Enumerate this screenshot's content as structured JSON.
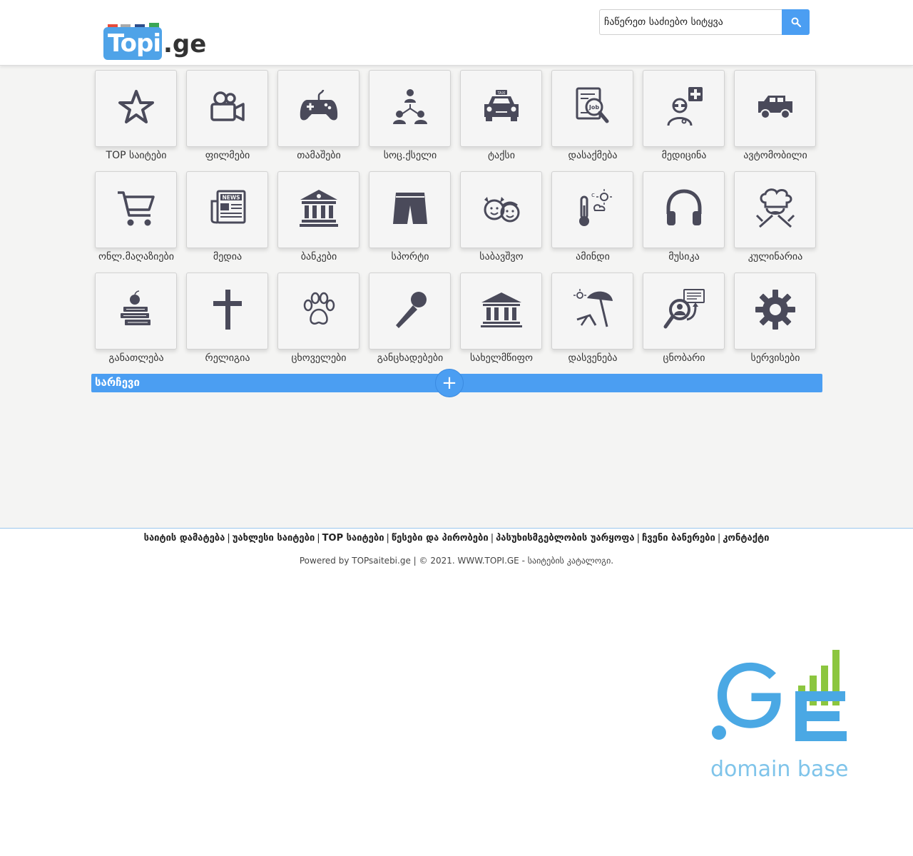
{
  "header": {
    "logo": {
      "main": "Topi",
      "suffix": ".ge"
    },
    "search": {
      "placeholder": "ჩაწერეთ საძიებო სიტყვა",
      "button_icon": "search-icon"
    }
  },
  "categories": [
    {
      "label": "TOP საიტები",
      "icon": "star-icon"
    },
    {
      "label": "ფილმები",
      "icon": "video-camera-icon"
    },
    {
      "label": "თამაშები",
      "icon": "gamepad-icon"
    },
    {
      "label": "სოც.ქსელი",
      "icon": "social-network-icon"
    },
    {
      "label": "ტაქსი",
      "icon": "taxi-icon"
    },
    {
      "label": "დასაქმება",
      "icon": "job-search-icon"
    },
    {
      "label": "მედიცინა",
      "icon": "doctor-icon"
    },
    {
      "label": "ავტომობილი",
      "icon": "jeep-icon"
    },
    {
      "label": "ონლ.მაღაზიები",
      "icon": "shopping-cart-icon"
    },
    {
      "label": "მედია",
      "icon": "newspaper-icon"
    },
    {
      "label": "ბანკები",
      "icon": "bank-icon"
    },
    {
      "label": "სპორტი",
      "icon": "shorts-icon"
    },
    {
      "label": "საბავშვო",
      "icon": "kids-icon"
    },
    {
      "label": "ამინდი",
      "icon": "thermometer-icon"
    },
    {
      "label": "მუსიკა",
      "icon": "headphones-icon"
    },
    {
      "label": "კულინარია",
      "icon": "chef-icon"
    },
    {
      "label": "განათლება",
      "icon": "books-apple-icon"
    },
    {
      "label": "რელიგია",
      "icon": "cross-icon"
    },
    {
      "label": "ცხოველები",
      "icon": "paw-icon"
    },
    {
      "label": "განცხადებები",
      "icon": "microphone-icon"
    },
    {
      "label": "სახელმწიფო",
      "icon": "government-building-icon"
    },
    {
      "label": "დასვენება",
      "icon": "beach-umbrella-icon"
    },
    {
      "label": "ცნობარი",
      "icon": "directory-search-icon"
    },
    {
      "label": "სერვისები",
      "icon": "gear-icon"
    }
  ],
  "favorites": {
    "label": "სარჩევი",
    "add_symbol": "+"
  },
  "footer": {
    "links": [
      "საიტის დამატება",
      "უახლესი საიტები",
      "TOP საიტები",
      "წესები და პირობები",
      "პასუხისმგებლობის უარყოფა",
      "ჩვენი ბანერები",
      "კონტაქტი"
    ],
    "separator": "|",
    "powered": "Powered by TOPsaitebi.ge | © 2021. WWW.TOPI.GE - საიტების კატალოგი.",
    "banner": {
      "logo_text": ".GE",
      "caption": "domain base"
    }
  },
  "colors": {
    "accent": "#4b9ef2",
    "icon": "#4a4a5a",
    "tile_bg": "#f5f5f5",
    "page_bg": "#f4f4f3"
  }
}
